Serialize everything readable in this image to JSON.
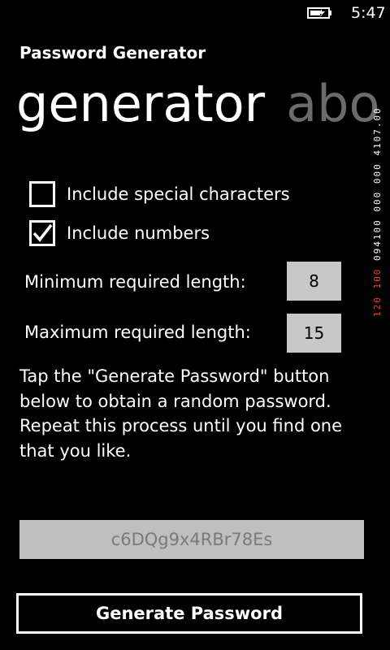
{
  "status": {
    "time": "5:47",
    "battery_icon": "battery-charging-icon"
  },
  "app": {
    "title": "Password Generator"
  },
  "pivot": {
    "current": "generator",
    "next": "abo"
  },
  "options": {
    "special_label": "Include special characters",
    "special_checked": false,
    "numbers_label": "Include numbers",
    "numbers_checked": true
  },
  "fields": {
    "min_label": "Minimum required length:",
    "min_value": "8",
    "max_label": "Maximum required length:",
    "max_value": "15"
  },
  "instructions": "Tap the \"Generate Password\" button below to obtain a random password. Repeat this process until you find one that you like.",
  "password": {
    "value": "c6DQg9x4RBr78Es"
  },
  "button": {
    "generate_label": "Generate Password"
  },
  "debug": {
    "perf_red": "120 100",
    "perf_white": "094100 000 000 4107.00"
  },
  "colors": {
    "background": "#000000",
    "field": "#c8c8c8",
    "pivot_inactive": "#6b6b6b",
    "perf_red": "#ff3b1f"
  }
}
